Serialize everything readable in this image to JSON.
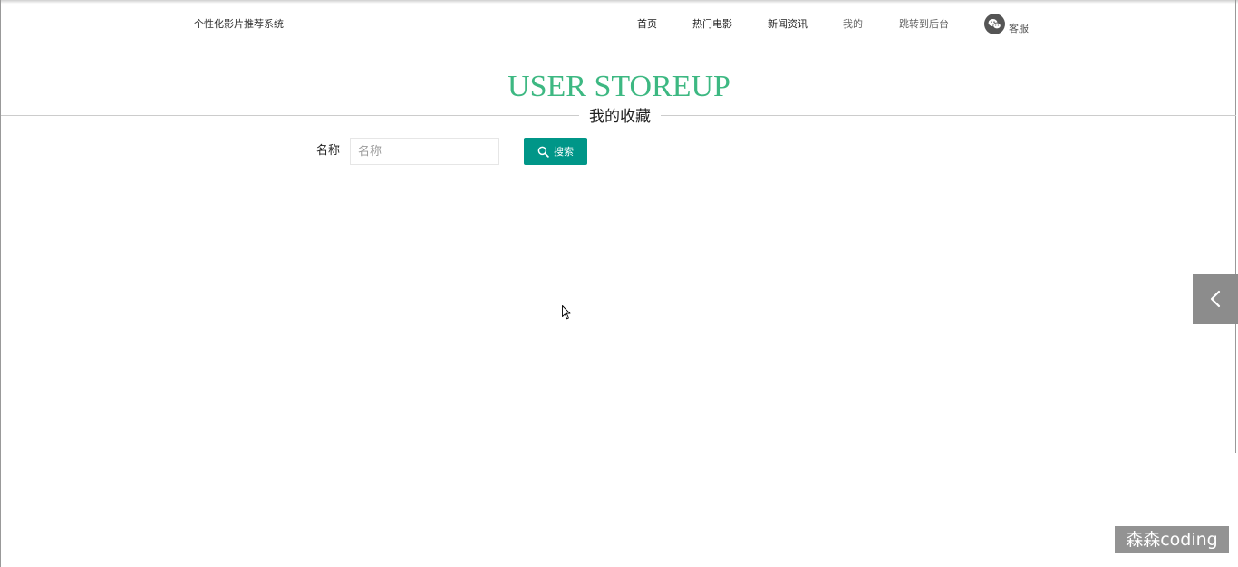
{
  "header": {
    "site_title": "个性化影片推荐系统",
    "nav": [
      {
        "label": "首页"
      },
      {
        "label": "热门电影"
      },
      {
        "label": "新闻资讯"
      },
      {
        "label": "我的"
      },
      {
        "label": "跳转到后台"
      }
    ],
    "customer_service": "客服"
  },
  "page": {
    "heading_en": "USER STOREUP",
    "heading_zh": "我的收藏"
  },
  "search": {
    "label": "名称",
    "placeholder": "名称",
    "value": "",
    "button_label": "搜索"
  },
  "watermark": "森森coding",
  "colors": {
    "accent_green": "#3db882",
    "button_teal": "#009688",
    "side_toggle": "#8c8c8c"
  },
  "icons": {
    "customer_service": "wechat-icon",
    "search_button": "search-icon",
    "side_toggle": "chevron-left-icon"
  }
}
